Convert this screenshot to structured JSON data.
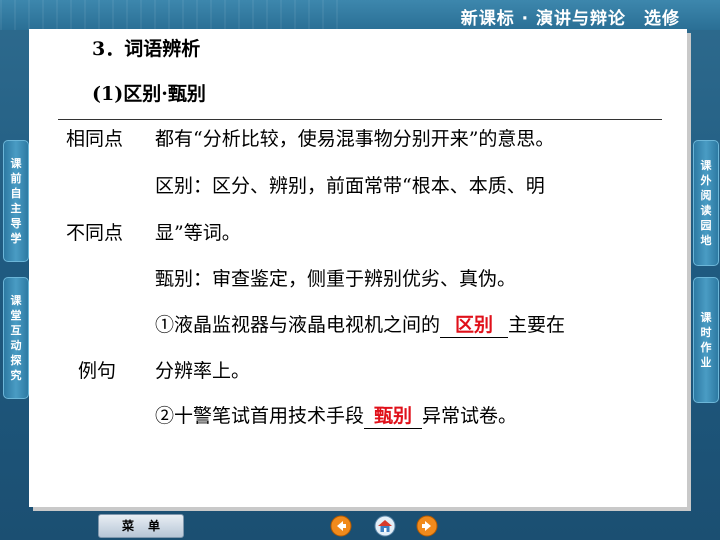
{
  "header": {
    "course_title": "新课标 · 演讲与辩论　选修"
  },
  "content": {
    "section_heading": "3．词语辨析",
    "subheading": "(1)区别·甄别",
    "rows": {
      "same_label": "相同点",
      "same_text": "都有“分析比较，使易混事物分别开来”的意思。",
      "diff_label": "不同点",
      "diff_line1": "区别：区分、辨别，前面常带“根本、本质、明",
      "diff_line2": "显”等词。",
      "diff_line3": "甄别：审查鉴定，侧重于辨别优劣、真伪。",
      "example_label": "例句",
      "ex1_before": "①液晶监视器与液晶电视机之间的",
      "ex1_answer": "区别",
      "ex1_after": "主要在",
      "ex1_line2": "分辨率上。",
      "ex2_before": "②十警笔试首用技术手段",
      "ex2_answer": "甄别",
      "ex2_after": "异常试卷。"
    }
  },
  "left_nav": [
    {
      "label": "课前自主导学"
    },
    {
      "label": "课堂互动探究"
    }
  ],
  "right_nav": [
    {
      "label": "课外阅读园地"
    },
    {
      "label": "课时作业"
    }
  ],
  "bottom": {
    "menu_label": "菜单"
  },
  "icons": {
    "prev": "arrow-left-icon",
    "home": "home-icon",
    "next": "arrow-right-icon"
  },
  "colors": {
    "answer": "#e0101a",
    "frame": "#1f5a80",
    "tab": "#2d7aa3"
  }
}
